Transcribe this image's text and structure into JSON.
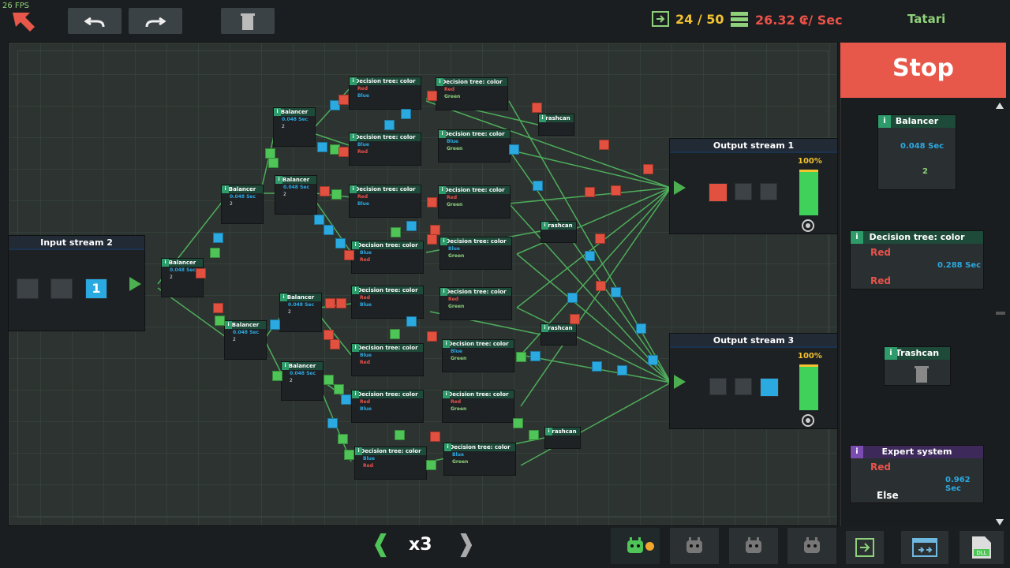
{
  "fps": "26 FPS",
  "toolbar": {
    "undo_icon": "undo-icon",
    "redo_icon": "redo-icon",
    "delete_icon": "trash-icon"
  },
  "stats": {
    "blocks": "24 / 50",
    "income": "26.32 ₢/ Sec"
  },
  "username": "Tatari",
  "streams": {
    "input": {
      "title": "Input stream 2",
      "highlight_value": "1"
    },
    "output1": {
      "title": "Output stream 1",
      "percent": "100%"
    },
    "output3": {
      "title": "Output stream 3",
      "percent": "100%"
    }
  },
  "nodes": {
    "balancer": {
      "title": "Balancer",
      "speed": "0.048 Sec",
      "count": "2"
    },
    "decision": {
      "title": "Decision tree: color",
      "speed": "0.288 Sec"
    },
    "trashcan": {
      "title": "Trashcan"
    }
  },
  "sidebar": {
    "stop_label": "Stop",
    "balancer": {
      "title": "Balancer",
      "speed": "0.048 Sec",
      "count": "2"
    },
    "decision": {
      "title": "Decision tree: color",
      "opt1": "Red",
      "opt2": "Red",
      "speed": "0.288 Sec"
    },
    "trashcan": {
      "title": "Trashcan"
    },
    "expert": {
      "title": "Expert system",
      "opt1": "Red",
      "opt2": "Else",
      "speed": "0.962 Sec"
    }
  },
  "speed_control": {
    "value": "x3",
    "left": "❰",
    "right": "❱"
  },
  "colors": {
    "red": "#e2513f",
    "blue": "#2ba9e1",
    "green": "#4fc457",
    "accent": "#e8584a"
  }
}
